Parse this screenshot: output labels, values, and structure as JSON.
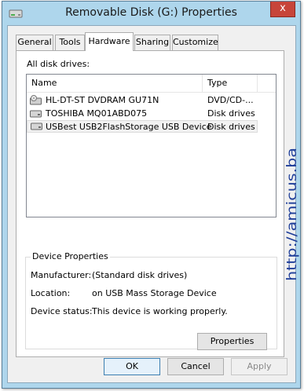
{
  "window": {
    "title": "Removable Disk (G:) Properties",
    "close_glyph": "x"
  },
  "tabs": [
    {
      "label": "General"
    },
    {
      "label": "Tools"
    },
    {
      "label": "Hardware"
    },
    {
      "label": "Sharing"
    },
    {
      "label": "Customize"
    }
  ],
  "hardware": {
    "all_disk_drives_label": "All disk drives:",
    "columns": {
      "name": "Name",
      "type": "Type"
    },
    "drives": [
      {
        "name": "HL-DT-ST DVDRAM GU71N",
        "type": "DVD/CD-...",
        "icon": "optical-drive-icon"
      },
      {
        "name": "TOSHIBA MQ01ABD075",
        "type": "Disk drives",
        "icon": "disk-drive-icon"
      },
      {
        "name": "USBest USB2FlashStorage USB Device",
        "type": "Disk drives",
        "icon": "disk-drive-icon",
        "selected": true
      }
    ],
    "device_properties": {
      "title": "Device Properties",
      "manufacturer_label": "Manufacturer:",
      "manufacturer_value": "(Standard disk drives)",
      "location_label": "Location:",
      "location_value": "on USB Mass Storage Device",
      "status_label": "Device status:",
      "status_value": "This device is working properly.",
      "properties_button": "Properties"
    }
  },
  "footer": {
    "ok": "OK",
    "cancel": "Cancel",
    "apply": "Apply"
  },
  "watermark": "http://amicus.ba",
  "colors": {
    "frame": "#aed6ec",
    "close": "#c7453a",
    "watermark": "#1f3f9a",
    "focus_border": "#3c7fb1"
  }
}
